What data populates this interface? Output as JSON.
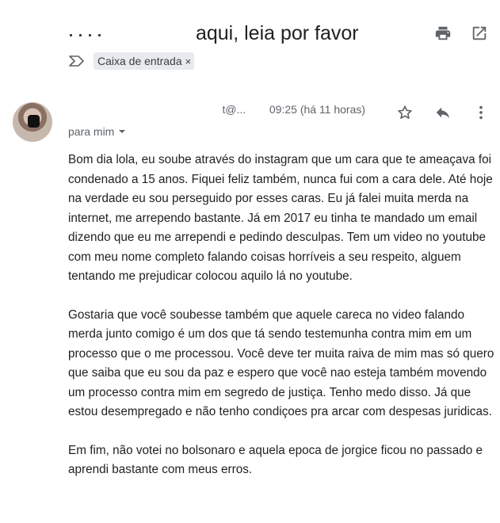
{
  "header": {
    "subject_visible": "aqui, leia por favor",
    "print_icon": "print-icon",
    "open_new_window_icon": "open-in-new-window-icon"
  },
  "labels": {
    "important_icon": "importance-marker-icon",
    "chip": "Caixa de entrada",
    "chip_remove": "×"
  },
  "message": {
    "sender_visible": "t@...",
    "time": "09:25 (há 11 horas)",
    "recipient": "para mim",
    "icons": [
      "star-icon",
      "reply-icon",
      "more-vert-icon"
    ],
    "paragraphs": [
      "Bom dia lola, eu soube através do instagram que um cara que te ameaçava foi condenado a 15 anos. Fiquei feliz também, nunca fui com a cara dele. Até hoje na verdade eu sou perseguido por esses caras. Eu já falei muita merda na internet, me arrependo bastante. Já em 2017 eu tinha te mandado um email dizendo que eu me arrependi e pedindo desculpas. Tem um video no youtube com meu nome completo falando coisas horríveis a seu respeito, alguem tentando me prejudicar colocou aquilo lá no youtube.",
      "Gostaria que você soubesse também que aquele careca no video falando merda junto comigo é um dos que tá sendo testemunha contra mim em um processo que o          me processou. Você deve ter muita raiva de mim mas só quero que saiba que eu sou da paz e espero que você nao esteja também movendo um processo contra mim em segredo de justiça. Tenho medo disso. Já que estou desempregado e não tenho condiçoes pra arcar com despesas juridicas.",
      "Em fim, não votei no bolsonaro e aquela epoca de jorgice ficou no passado e aprendi bastante com meus erros."
    ]
  }
}
